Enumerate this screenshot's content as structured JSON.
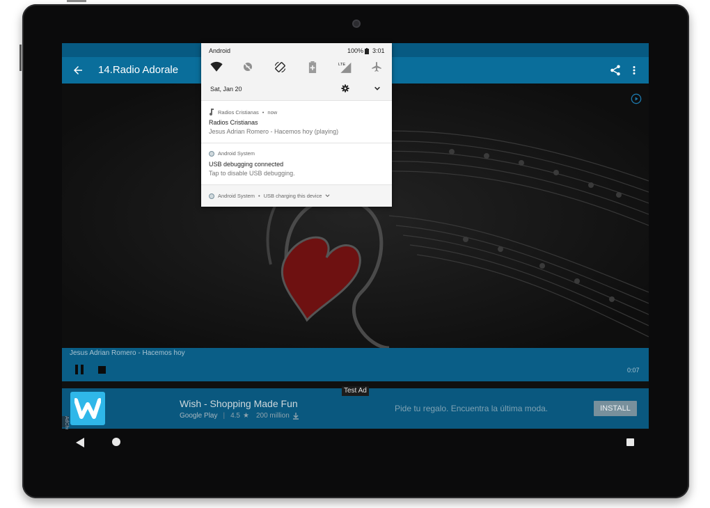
{
  "app": {
    "title": "14.Radio Adorale"
  },
  "player": {
    "track": "Jesus Adrian Romero - Hacemos hoy",
    "elapsed": "0:07"
  },
  "ad": {
    "label": "Test Ad",
    "title": "Wish - Shopping Made Fun",
    "store": "Google Play",
    "rating": "4.5",
    "downloads": "200 million",
    "tagline": "Pide tu regalo. Encuentra la última moda.",
    "install_label": "INSTALL",
    "adchoices_label": "AdChoices"
  },
  "shade": {
    "device_name": "Android",
    "battery": "100%",
    "clock": "3:01",
    "date": "Sat, Jan 20",
    "tiles": [
      "wifi-icon",
      "dnd-icon",
      "auto-rotate-icon",
      "battery-saver-icon",
      "lte-signal-icon",
      "airplane-icon"
    ],
    "notifications": [
      {
        "app": "Radios Cristianas",
        "when": "now",
        "title": "Radios Cristianas",
        "body": "Jesus Adrian Romero - Hacemos hoy (playing)"
      },
      {
        "app": "Android System",
        "title": "USB debugging connected",
        "body": "Tap to disable USB debugging."
      }
    ],
    "footer": {
      "app": "Android System",
      "text": "USB charging this device"
    }
  },
  "colors": {
    "toolbar": "#0a6e9b",
    "statusbar": "#075a82",
    "player": "#0a5e87",
    "ad_bg": "#0a587f",
    "wish_brand": "#2fb7e9"
  }
}
